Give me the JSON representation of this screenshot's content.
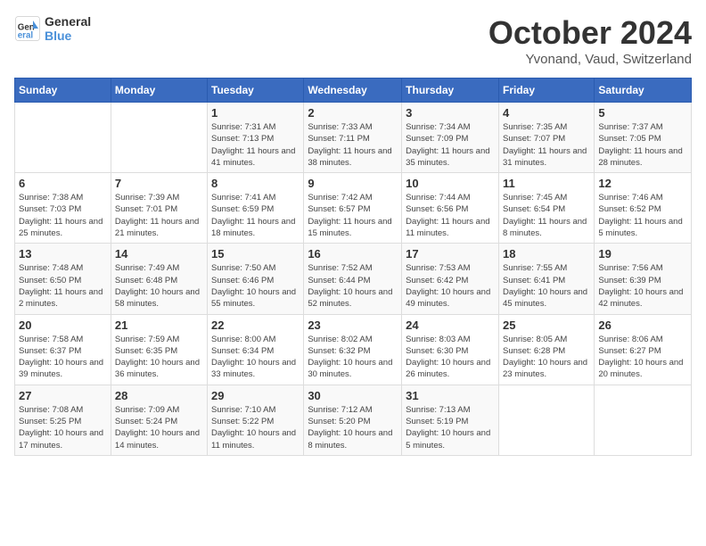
{
  "header": {
    "logo_line1": "General",
    "logo_line2": "Blue",
    "month": "October 2024",
    "location": "Yvonand, Vaud, Switzerland"
  },
  "days_of_week": [
    "Sunday",
    "Monday",
    "Tuesday",
    "Wednesday",
    "Thursday",
    "Friday",
    "Saturday"
  ],
  "weeks": [
    [
      {
        "day": "",
        "info": ""
      },
      {
        "day": "",
        "info": ""
      },
      {
        "day": "1",
        "sunrise": "Sunrise: 7:31 AM",
        "sunset": "Sunset: 7:13 PM",
        "daylight": "Daylight: 11 hours and 41 minutes."
      },
      {
        "day": "2",
        "sunrise": "Sunrise: 7:33 AM",
        "sunset": "Sunset: 7:11 PM",
        "daylight": "Daylight: 11 hours and 38 minutes."
      },
      {
        "day": "3",
        "sunrise": "Sunrise: 7:34 AM",
        "sunset": "Sunset: 7:09 PM",
        "daylight": "Daylight: 11 hours and 35 minutes."
      },
      {
        "day": "4",
        "sunrise": "Sunrise: 7:35 AM",
        "sunset": "Sunset: 7:07 PM",
        "daylight": "Daylight: 11 hours and 31 minutes."
      },
      {
        "day": "5",
        "sunrise": "Sunrise: 7:37 AM",
        "sunset": "Sunset: 7:05 PM",
        "daylight": "Daylight: 11 hours and 28 minutes."
      }
    ],
    [
      {
        "day": "6",
        "sunrise": "Sunrise: 7:38 AM",
        "sunset": "Sunset: 7:03 PM",
        "daylight": "Daylight: 11 hours and 25 minutes."
      },
      {
        "day": "7",
        "sunrise": "Sunrise: 7:39 AM",
        "sunset": "Sunset: 7:01 PM",
        "daylight": "Daylight: 11 hours and 21 minutes."
      },
      {
        "day": "8",
        "sunrise": "Sunrise: 7:41 AM",
        "sunset": "Sunset: 6:59 PM",
        "daylight": "Daylight: 11 hours and 18 minutes."
      },
      {
        "day": "9",
        "sunrise": "Sunrise: 7:42 AM",
        "sunset": "Sunset: 6:57 PM",
        "daylight": "Daylight: 11 hours and 15 minutes."
      },
      {
        "day": "10",
        "sunrise": "Sunrise: 7:44 AM",
        "sunset": "Sunset: 6:56 PM",
        "daylight": "Daylight: 11 hours and 11 minutes."
      },
      {
        "day": "11",
        "sunrise": "Sunrise: 7:45 AM",
        "sunset": "Sunset: 6:54 PM",
        "daylight": "Daylight: 11 hours and 8 minutes."
      },
      {
        "day": "12",
        "sunrise": "Sunrise: 7:46 AM",
        "sunset": "Sunset: 6:52 PM",
        "daylight": "Daylight: 11 hours and 5 minutes."
      }
    ],
    [
      {
        "day": "13",
        "sunrise": "Sunrise: 7:48 AM",
        "sunset": "Sunset: 6:50 PM",
        "daylight": "Daylight: 11 hours and 2 minutes."
      },
      {
        "day": "14",
        "sunrise": "Sunrise: 7:49 AM",
        "sunset": "Sunset: 6:48 PM",
        "daylight": "Daylight: 10 hours and 58 minutes."
      },
      {
        "day": "15",
        "sunrise": "Sunrise: 7:50 AM",
        "sunset": "Sunset: 6:46 PM",
        "daylight": "Daylight: 10 hours and 55 minutes."
      },
      {
        "day": "16",
        "sunrise": "Sunrise: 7:52 AM",
        "sunset": "Sunset: 6:44 PM",
        "daylight": "Daylight: 10 hours and 52 minutes."
      },
      {
        "day": "17",
        "sunrise": "Sunrise: 7:53 AM",
        "sunset": "Sunset: 6:42 PM",
        "daylight": "Daylight: 10 hours and 49 minutes."
      },
      {
        "day": "18",
        "sunrise": "Sunrise: 7:55 AM",
        "sunset": "Sunset: 6:41 PM",
        "daylight": "Daylight: 10 hours and 45 minutes."
      },
      {
        "day": "19",
        "sunrise": "Sunrise: 7:56 AM",
        "sunset": "Sunset: 6:39 PM",
        "daylight": "Daylight: 10 hours and 42 minutes."
      }
    ],
    [
      {
        "day": "20",
        "sunrise": "Sunrise: 7:58 AM",
        "sunset": "Sunset: 6:37 PM",
        "daylight": "Daylight: 10 hours and 39 minutes."
      },
      {
        "day": "21",
        "sunrise": "Sunrise: 7:59 AM",
        "sunset": "Sunset: 6:35 PM",
        "daylight": "Daylight: 10 hours and 36 minutes."
      },
      {
        "day": "22",
        "sunrise": "Sunrise: 8:00 AM",
        "sunset": "Sunset: 6:34 PM",
        "daylight": "Daylight: 10 hours and 33 minutes."
      },
      {
        "day": "23",
        "sunrise": "Sunrise: 8:02 AM",
        "sunset": "Sunset: 6:32 PM",
        "daylight": "Daylight: 10 hours and 30 minutes."
      },
      {
        "day": "24",
        "sunrise": "Sunrise: 8:03 AM",
        "sunset": "Sunset: 6:30 PM",
        "daylight": "Daylight: 10 hours and 26 minutes."
      },
      {
        "day": "25",
        "sunrise": "Sunrise: 8:05 AM",
        "sunset": "Sunset: 6:28 PM",
        "daylight": "Daylight: 10 hours and 23 minutes."
      },
      {
        "day": "26",
        "sunrise": "Sunrise: 8:06 AM",
        "sunset": "Sunset: 6:27 PM",
        "daylight": "Daylight: 10 hours and 20 minutes."
      }
    ],
    [
      {
        "day": "27",
        "sunrise": "Sunrise: 7:08 AM",
        "sunset": "Sunset: 5:25 PM",
        "daylight": "Daylight: 10 hours and 17 minutes."
      },
      {
        "day": "28",
        "sunrise": "Sunrise: 7:09 AM",
        "sunset": "Sunset: 5:24 PM",
        "daylight": "Daylight: 10 hours and 14 minutes."
      },
      {
        "day": "29",
        "sunrise": "Sunrise: 7:10 AM",
        "sunset": "Sunset: 5:22 PM",
        "daylight": "Daylight: 10 hours and 11 minutes."
      },
      {
        "day": "30",
        "sunrise": "Sunrise: 7:12 AM",
        "sunset": "Sunset: 5:20 PM",
        "daylight": "Daylight: 10 hours and 8 minutes."
      },
      {
        "day": "31",
        "sunrise": "Sunrise: 7:13 AM",
        "sunset": "Sunset: 5:19 PM",
        "daylight": "Daylight: 10 hours and 5 minutes."
      },
      {
        "day": "",
        "info": ""
      },
      {
        "day": "",
        "info": ""
      }
    ]
  ]
}
